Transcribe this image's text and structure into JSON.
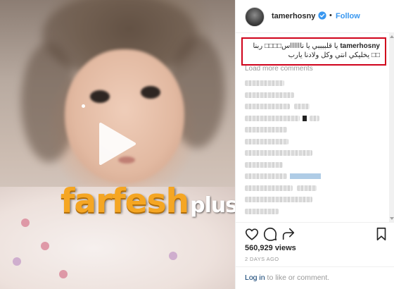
{
  "post": {
    "username": "tamerhosny",
    "follow_label": "Follow",
    "separator": "•",
    "caption": {
      "username": "tamerhosny",
      "text_line1": "يا قلببببي يا نااااااس□□□□ ربنا",
      "text_line2": "□□ يخليكي انتي وكل ولادنا يارب"
    },
    "load_more": "Load more comments",
    "views": "560,929 views",
    "timestamp": "2 DAYS AGO",
    "login": {
      "link": "Log in",
      "rest": " to like or comment."
    }
  },
  "media": {
    "watermark_main": "farfesh",
    "watermark_sub": "plus.com"
  },
  "icons": {
    "verified": "verified-badge-icon",
    "play": "play-icon",
    "like": "heart-icon",
    "comment": "comment-icon",
    "share": "share-icon",
    "save": "bookmark-icon"
  },
  "colors": {
    "follow": "#3897f0",
    "highlight_border": "#d0021b",
    "watermark": "#f5a623",
    "verified": "#3897f0"
  }
}
